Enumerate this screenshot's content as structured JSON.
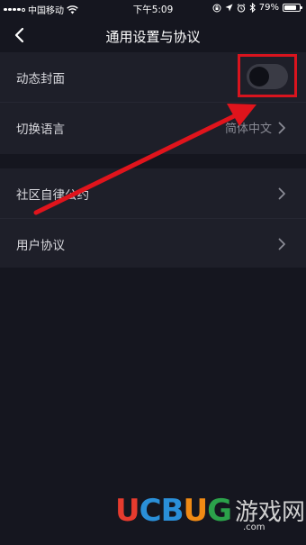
{
  "status_bar": {
    "carrier": "中国移动",
    "time": "下午5:09",
    "battery": "79%"
  },
  "nav": {
    "title": "通用设置与协议"
  },
  "settings": {
    "dynamic_cover": {
      "label": "动态封面",
      "enabled": false
    },
    "language": {
      "label": "切换语言",
      "value": "简体中文"
    },
    "community": {
      "label": "社区自律公约"
    },
    "user_agreement": {
      "label": "用户协议"
    }
  },
  "watermark": {
    "brand": "UCBUG",
    "chinese": "游戏网",
    "url": ".com"
  },
  "colors": {
    "background": "#15161f",
    "row_background": "#1e1f29",
    "annotation_red": "#d8141e"
  }
}
